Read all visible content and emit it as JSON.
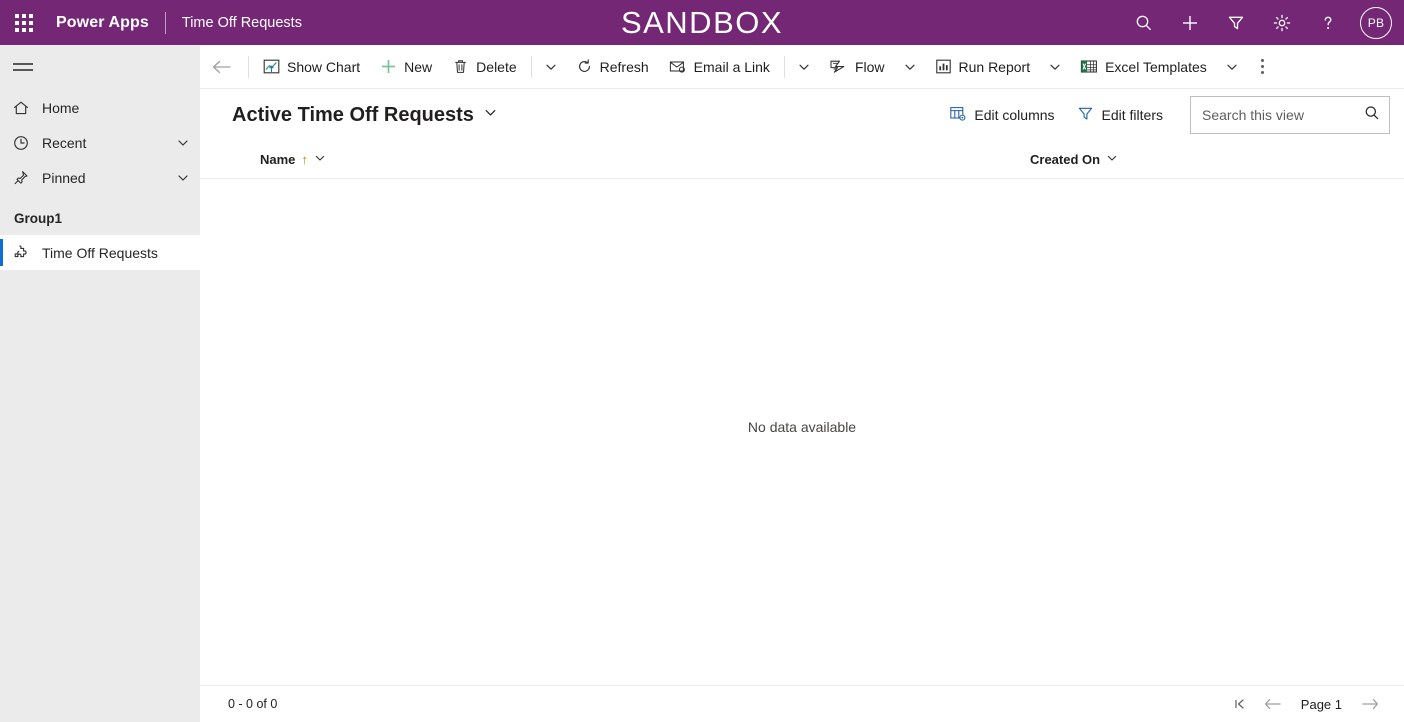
{
  "header": {
    "waffle_icon": "app-launcher-grid-icon",
    "brand": "Power Apps",
    "app_name": "Time Off Requests",
    "environment_banner": "SANDBOX",
    "brand_color": "#742774",
    "actions": [
      {
        "name": "search-icon",
        "label": "Search"
      },
      {
        "name": "add-icon",
        "label": "New"
      },
      {
        "name": "filter-icon",
        "label": "Filter"
      },
      {
        "name": "gear-icon",
        "label": "Settings"
      },
      {
        "name": "help-icon",
        "label": "Help"
      }
    ],
    "avatar_initials": "PB"
  },
  "sidebar": {
    "hamburger_label": "Site Map",
    "items": [
      {
        "label": "Home",
        "icon": "home-icon",
        "chevron": false
      },
      {
        "label": "Recent",
        "icon": "clock-icon",
        "chevron": true
      },
      {
        "label": "Pinned",
        "icon": "pin-icon",
        "chevron": true
      }
    ],
    "group_label": "Group1",
    "entity": {
      "label": "Time Off Requests",
      "icon": "puzzle-icon",
      "selected": true
    },
    "selected_indicator_color": "#0b6fd4"
  },
  "commandbar": {
    "back_label": "Back",
    "buttons": [
      {
        "label": "Show Chart",
        "icon": "show-chart-icon"
      },
      {
        "label": "New",
        "icon": "add-green-icon"
      },
      {
        "label": "Delete",
        "icon": "trash-icon"
      },
      {
        "label": "Refresh",
        "icon": "refresh-icon"
      },
      {
        "label": "Email a Link",
        "icon": "email-link-icon"
      },
      {
        "label": "Flow",
        "icon": "flow-icon"
      },
      {
        "label": "Run Report",
        "icon": "report-icon"
      },
      {
        "label": "Excel Templates",
        "icon": "excel-icon"
      }
    ],
    "overflow_label": "More commands"
  },
  "view": {
    "title": "Active Time Off Requests",
    "edit_columns_label": "Edit columns",
    "edit_filters_label": "Edit filters",
    "search_placeholder": "Search this view",
    "search_value": ""
  },
  "grid": {
    "columns": [
      {
        "label": "Name",
        "sorted": "asc"
      },
      {
        "label": "Created On",
        "sorted": "none"
      }
    ],
    "sort_arrow": "↑",
    "empty_message": "No data available",
    "rows": []
  },
  "footer": {
    "record_count": "0 - 0 of 0",
    "page_label": "Page 1",
    "first_page_label": "First page",
    "previous_page_label": "Previous page",
    "next_page_label": "Next page"
  }
}
